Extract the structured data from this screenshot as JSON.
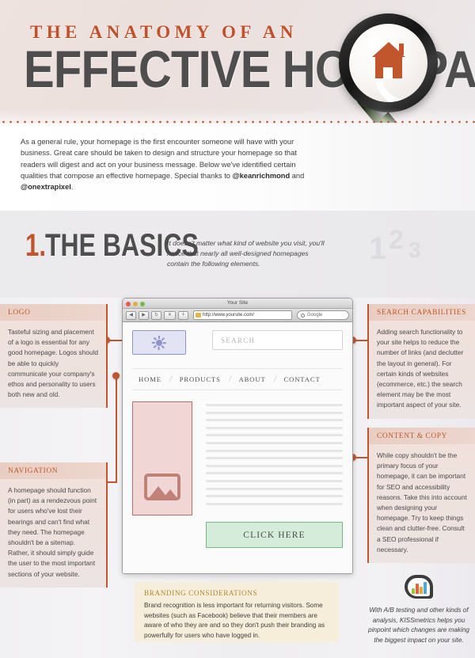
{
  "header": {
    "title_top": "THE ANATOMY OF AN",
    "title_main": "EFFECTIVE HOMEPAGE",
    "magnifier_icon": "magnifying-glass-icon",
    "house_icon": "house-icon"
  },
  "intro": {
    "line1": "As a general rule, your homepage is the first encounter someone will have with your business. Great care should be taken to design and structure your homepage so that readers will digest and act on your business message. Below we've identified certain qualities that compose an effective homepage. Special thanks to ",
    "handle1": "@keanrichmond",
    "mid": " and ",
    "handle2": "@onextrapixel",
    "end": "."
  },
  "basics": {
    "number": "1.",
    "title": "THE BASICS",
    "description": "It doesn't matter what kind of website you visit, you'll notice that nearly all well-designed homepages contain the following elements.",
    "deco": {
      "one": "1",
      "two": "2",
      "three": "3"
    }
  },
  "browser": {
    "window_title": "Your Site",
    "url": "http://www.yoursite.com/",
    "search_engine": "Google",
    "nav_back": "◀",
    "nav_forward": "▶",
    "reload": "↻",
    "stop": "✕",
    "add": "＋",
    "site": {
      "logo_icon": "sun-logo-icon",
      "search_placeholder": "SEARCH",
      "nav": [
        "HOME",
        "PRODUCTS",
        "ABOUT",
        "CONTACT"
      ],
      "nav_separator": "/",
      "image_placeholder_icon": "image-placeholder-icon",
      "cta_label": "CLICK HERE"
    }
  },
  "cards": {
    "logo": {
      "title": "LOGO",
      "body": "Tasteful sizing and placement of a logo is essential for any good homepage. Logos should be able to quickly communicate your company's ethos and personality to users both new and old."
    },
    "navigation": {
      "title": "NAVIGATION",
      "body": "A homepage should function (in part) as a rendezvous point for users who've lost their bearings and can't find what they need. The homepage shouldn't be a sitemap. Rather, it should simply guide the user to the most important sections of your website."
    },
    "search": {
      "title": "SEARCH CAPABILITIES",
      "body": "Adding search functionality to your site helps to reduce the number of links (and declutter the layout in general). For certain kinds of websites (ecommerce, etc.) the search element may be the most important aspect of your site."
    },
    "content": {
      "title": "CONTENT & COPY",
      "body": "While copy shouldn't be the primary focus of your homepage, it can be important for SEO and accessibility reasons. Take this into account when designing your homepage. Try to keep things clean and clutter-free. Consult a SEO professional if necessary."
    }
  },
  "branding": {
    "title": "BRANDING CONSIDERATIONS",
    "body": "Brand recognition is less important for returning visitors. Some websites (such as Facebook) believe that their members are aware of who they are and so they don't push their branding as powerfully for users who have logged in."
  },
  "kissmetrics": {
    "logo_icon": "kissmetrics-cloud-logo-icon",
    "text": "With A/B testing and other kinds of analysis, KISSmetrics helps you pinpoint which changes are making the biggest impact on your site."
  },
  "colors": {
    "accent": "#c1562b",
    "dark_text": "#4e4e4e",
    "card_bg": "#eee2dd",
    "branding_bg": "#f6eeda",
    "branding_title": "#b08a2e",
    "cta_green": "#d6ecda",
    "image_pink": "#f0d6d4",
    "logo_periwinkle": "#e2e4f4"
  }
}
